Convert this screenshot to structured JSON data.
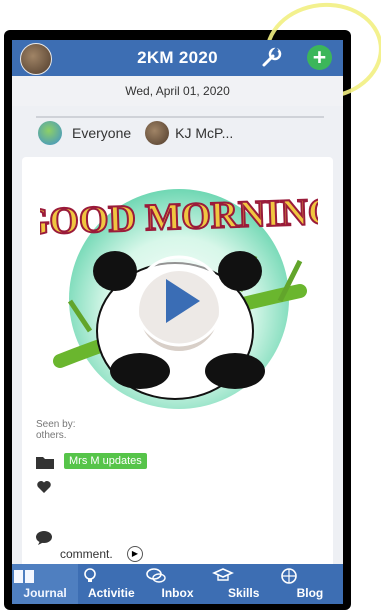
{
  "header": {
    "title": "2KM 2020"
  },
  "journal": {
    "date": "Wed, April 01, 2020",
    "audience": {
      "everyone_label": "Everyone",
      "user_label": "KJ McP..."
    },
    "post": {
      "image_text": "GOOD MORNING",
      "seen_by_line1": "Seen by:",
      "seen_by_line2": "others.",
      "folder_tag": "Mrs M updates",
      "comment_label": "comment."
    }
  },
  "bottom_nav": {
    "items": [
      {
        "label": "Journal"
      },
      {
        "label": "Activitie"
      },
      {
        "label": "Inbox"
      },
      {
        "label": "Skills"
      },
      {
        "label": "Blog"
      }
    ]
  },
  "colors": {
    "brand_blue": "#3d6eb3",
    "add_green": "#3cb65a",
    "tag_green": "#56c449",
    "highlight_yellow": "#f2ef82"
  }
}
